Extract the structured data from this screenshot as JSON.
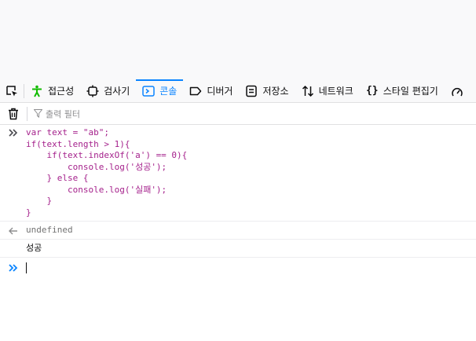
{
  "tabs": [
    {
      "label": "접근성",
      "icon": "accessibility-icon"
    },
    {
      "label": "검사기",
      "icon": "inspector-icon"
    },
    {
      "label": "콘솔",
      "icon": "console-icon",
      "active": true
    },
    {
      "label": "디버거",
      "icon": "debugger-icon"
    },
    {
      "label": "저장소",
      "icon": "storage-icon"
    },
    {
      "label": "네트워크",
      "icon": "network-icon"
    },
    {
      "label": "스타일 편집기",
      "icon": "style-editor-icon"
    }
  ],
  "toolbar": {
    "filter_placeholder": "출력 필터"
  },
  "console": {
    "input_lines": [
      "var text = \"ab\";",
      "if(text.length > 1){",
      "    if(text.indexOf('a') == 0){",
      "        console.log('성공');",
      "    } else {",
      "        console.log('실패');",
      "    }",
      "}"
    ],
    "result": "undefined",
    "log_output": "성공"
  },
  "colors": {
    "accent": "#0a84ff",
    "code": "#a5228c",
    "accessibility_icon": "#12bc00"
  }
}
